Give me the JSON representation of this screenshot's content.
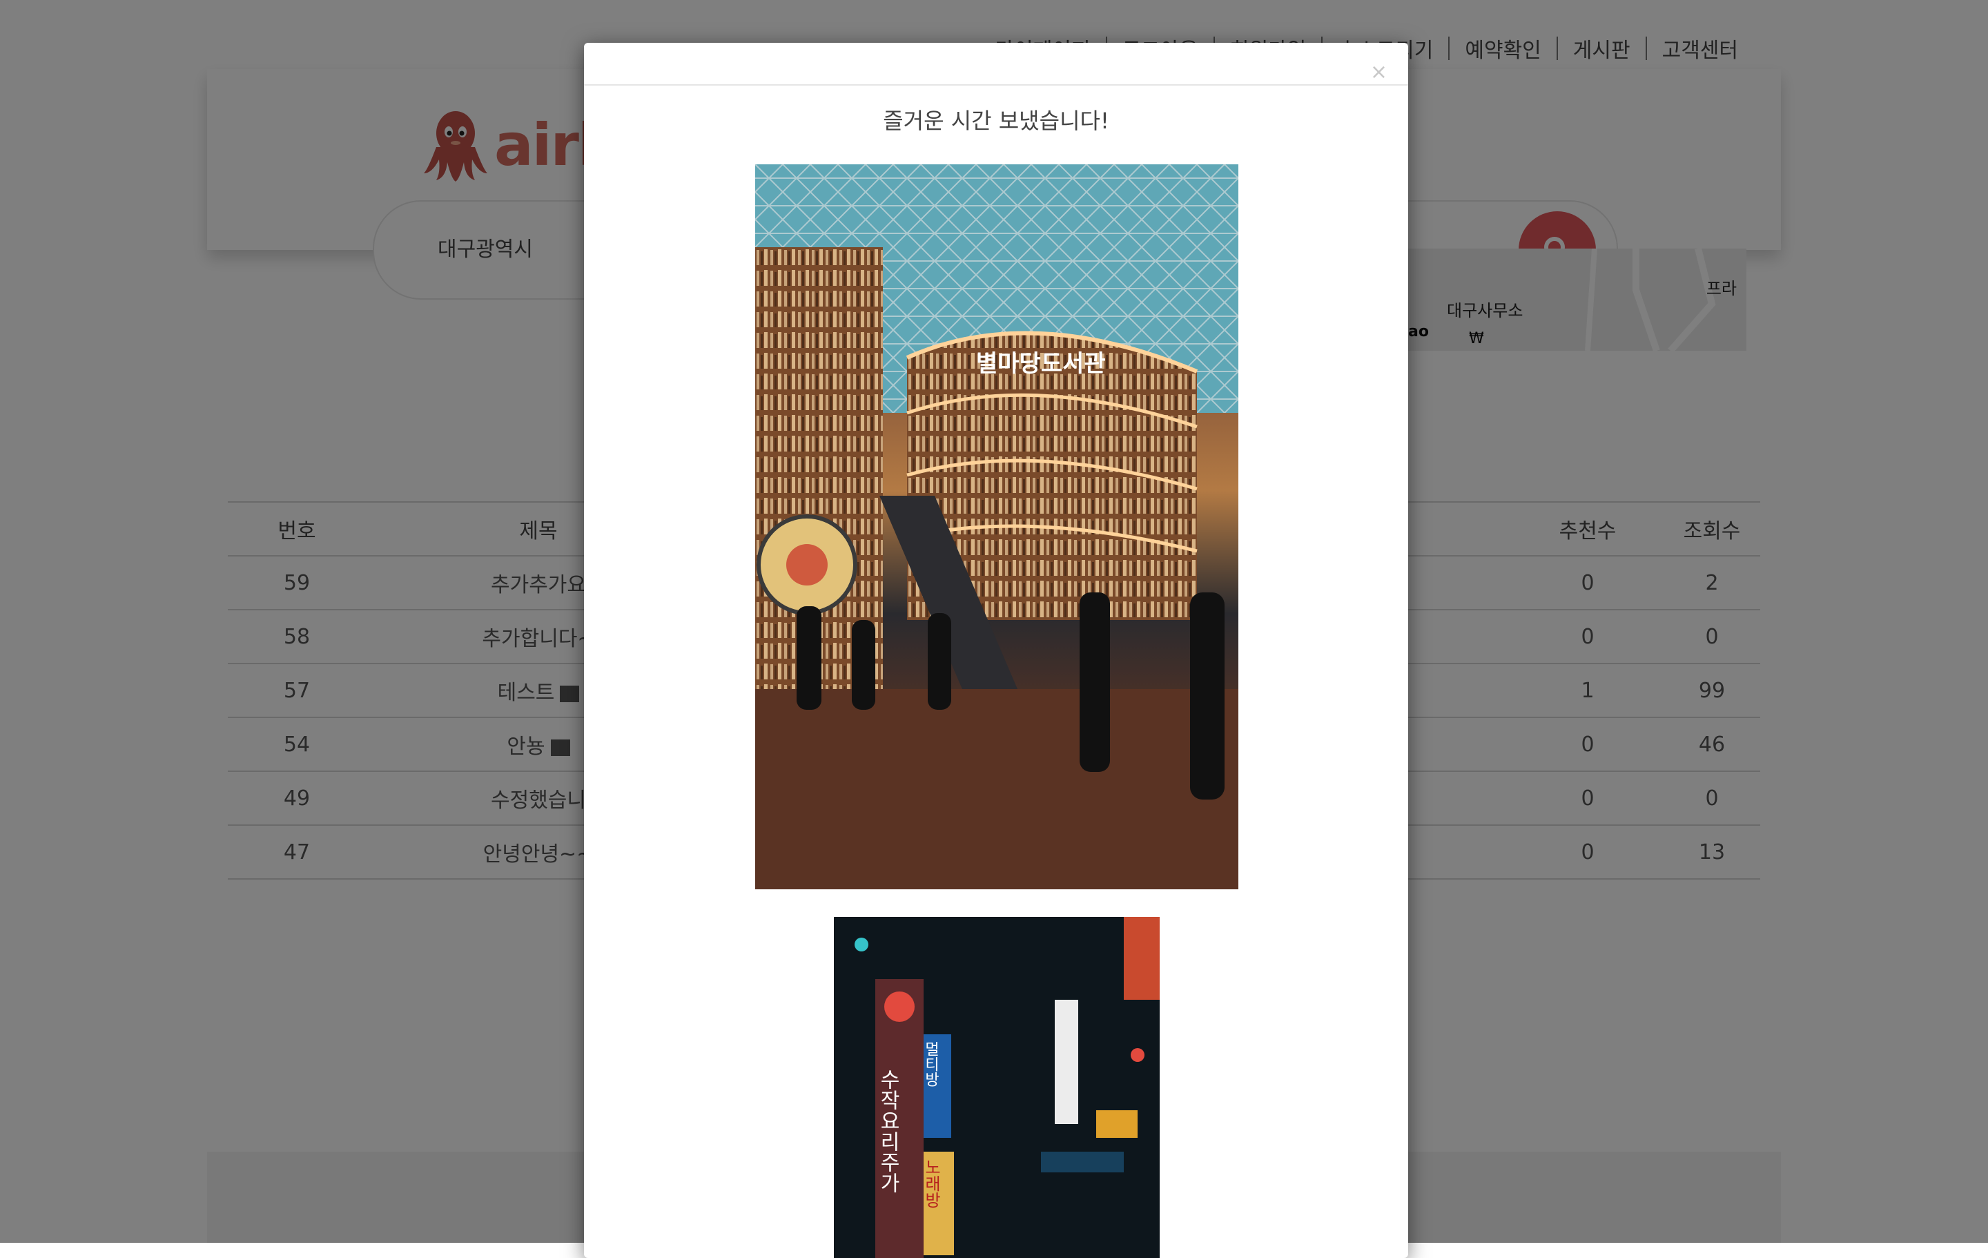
{
  "topnav": [
    "마이페이지",
    "로그아웃",
    "회원가입",
    "호스트되기",
    "예약확인",
    "게시판",
    "고객센터"
  ],
  "logo": {
    "text": "airb"
  },
  "search": {
    "location": "대구광역시"
  },
  "map": {
    "label_office": "대구사무소",
    "label_pr": "프라",
    "label_kakao": "ao",
    "currency": "₩"
  },
  "board": {
    "headers": [
      "번호",
      "제목",
      "추천수",
      "조회수"
    ],
    "rows": [
      {
        "no": "59",
        "title": "추가추가요",
        "likes": "0",
        "views": "2"
      },
      {
        "no": "58",
        "title": "추가합니다~",
        "likes": "0",
        "views": "0"
      },
      {
        "no": "57",
        "title": "테스트",
        "likes": "1",
        "views": "99"
      },
      {
        "no": "54",
        "title": "안뇽",
        "likes": "0",
        "views": "46"
      },
      {
        "no": "49",
        "title": "수정했습니",
        "likes": "0",
        "views": "0"
      },
      {
        "no": "47",
        "title": "안녕안녕~~",
        "likes": "0",
        "views": "13"
      }
    ]
  },
  "modal": {
    "close_label": "×",
    "title": "즐거운 시간 보냈습니다!",
    "photo1_sign": "별마당도서관",
    "photo2_signs": [
      "수작요리주가",
      "노래방",
      "멀티방"
    ]
  },
  "colors": {
    "accent": "#e0575b",
    "logo": "#d26a5e"
  }
}
